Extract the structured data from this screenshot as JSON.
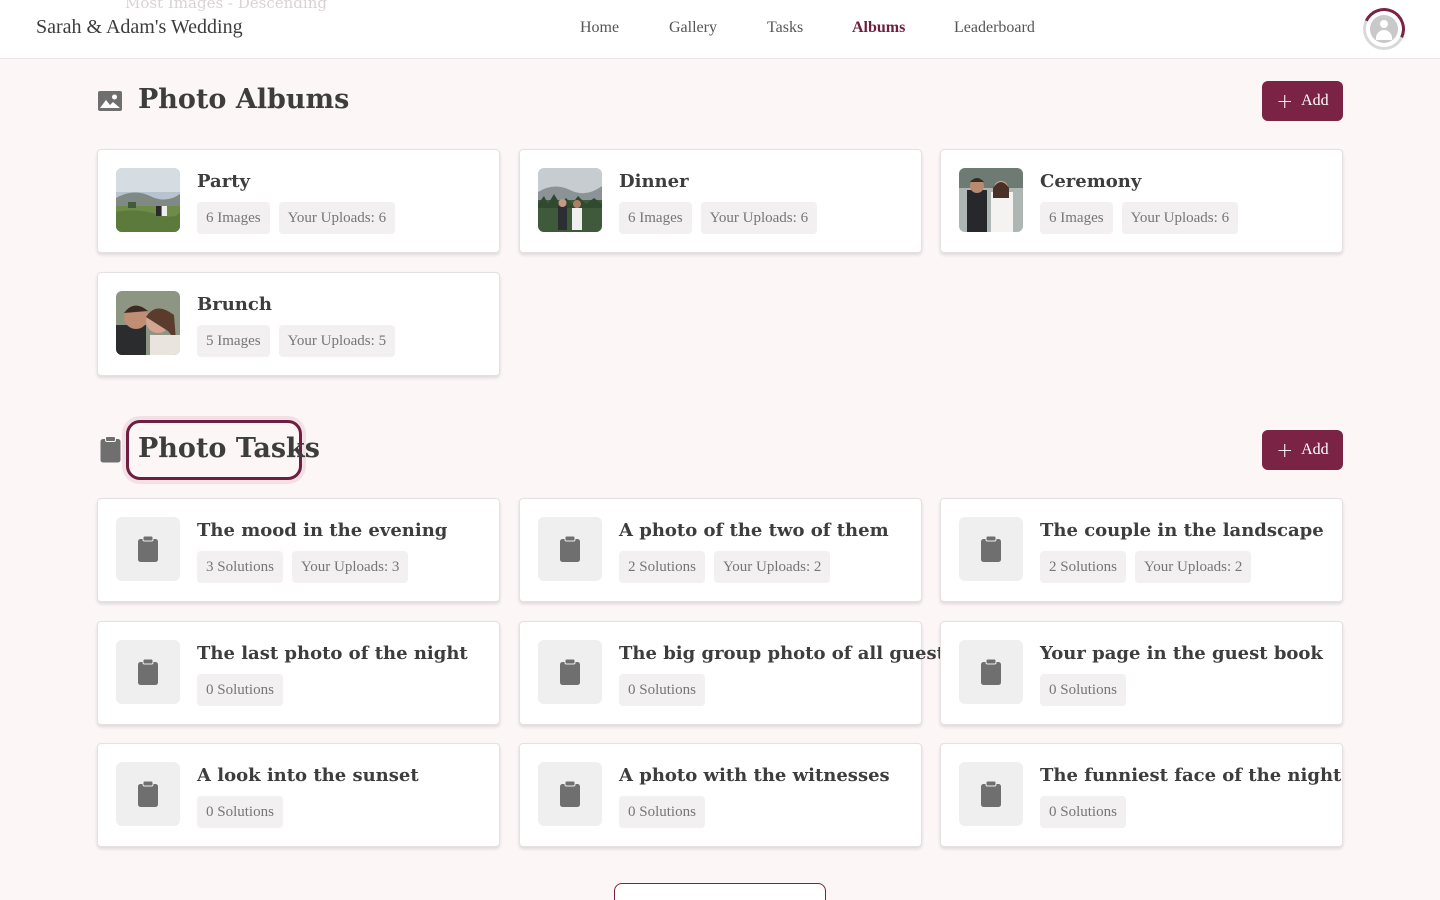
{
  "header": {
    "brand": "Sarah & Adam's Wedding",
    "ghost_text": "Most Images - Descending",
    "nav": [
      {
        "label": "Home",
        "active": false
      },
      {
        "label": "Gallery",
        "active": false
      },
      {
        "label": "Tasks",
        "active": false
      },
      {
        "label": "Albums",
        "active": true
      },
      {
        "label": "Leaderboard",
        "active": false
      }
    ],
    "avatar_icon": "user-avatar-icon"
  },
  "albums_section": {
    "title": "Photo Albums",
    "icon": "image-icon",
    "add_label": "Add",
    "albums": [
      {
        "name": "Party",
        "images": "6 Images",
        "uploads": "Your Uploads: 6"
      },
      {
        "name": "Dinner",
        "images": "6 Images",
        "uploads": "Your Uploads: 6"
      },
      {
        "name": "Ceremony",
        "images": "6 Images",
        "uploads": "Your Uploads: 6"
      },
      {
        "name": "Brunch",
        "images": "5 Images",
        "uploads": "Your Uploads: 5"
      }
    ]
  },
  "tasks_section": {
    "title": "Photo Tasks",
    "icon": "clipboard-icon",
    "add_label": "Add",
    "tasks": [
      {
        "name": "The mood in the evening",
        "solutions": "3 Solutions",
        "uploads": "Your Uploads: 3"
      },
      {
        "name": "A photo of the two of them",
        "solutions": "2 Solutions",
        "uploads": "Your Uploads: 2"
      },
      {
        "name": "The couple in the landscape",
        "solutions": "2 Solutions",
        "uploads": "Your Uploads: 2"
      },
      {
        "name": "The last photo of the night",
        "solutions": "0 Solutions"
      },
      {
        "name": "The big group photo of all guests",
        "solutions": "0 Solutions"
      },
      {
        "name": "Your page in the guest book",
        "solutions": "0 Solutions"
      },
      {
        "name": "A look into the sunset",
        "solutions": "0 Solutions"
      },
      {
        "name": "A photo with the witnesses",
        "solutions": "0 Solutions"
      },
      {
        "name": "The funniest face of the night",
        "solutions": "0 Solutions"
      }
    ]
  },
  "colors": {
    "accent": "#7a2345",
    "background": "#fcf6f7",
    "chip": "#f2f0f1"
  }
}
